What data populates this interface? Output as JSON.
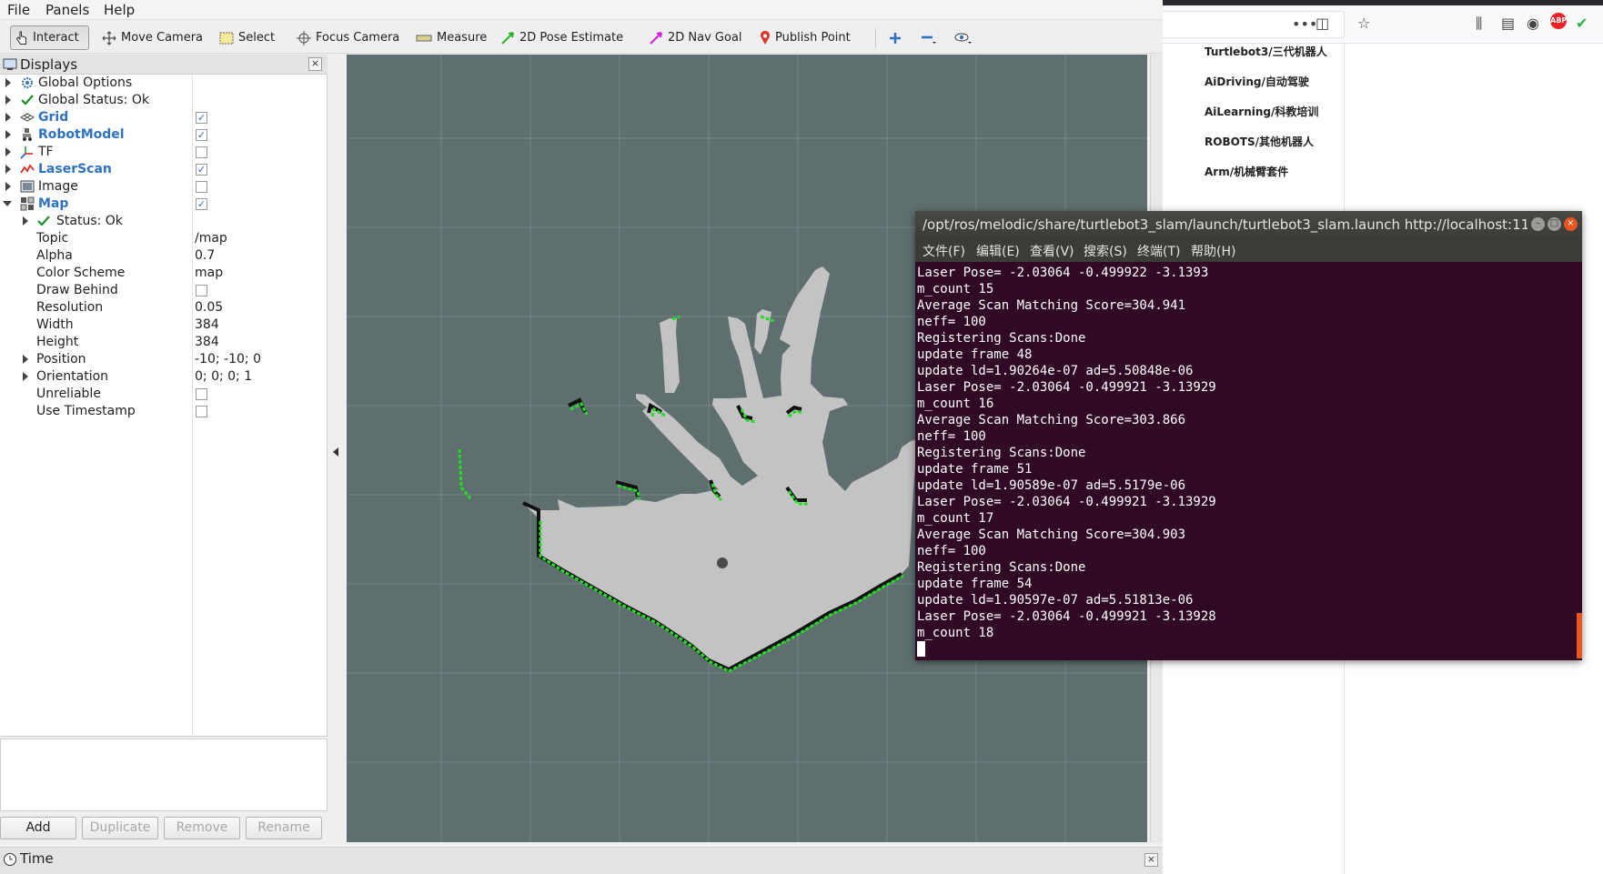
{
  "menubar": {
    "file": "File",
    "panels": "Panels",
    "help": "Help"
  },
  "toolbar": {
    "interact": "Interact",
    "move_camera": "Move Camera",
    "select": "Select",
    "focus_camera": "Focus Camera",
    "measure": "Measure",
    "pose_estimate": "2D Pose Estimate",
    "nav_goal": "2D Nav Goal",
    "publish_point": "Publish Point"
  },
  "displays": {
    "title": "Displays",
    "rows": [
      {
        "label": "Global Options"
      },
      {
        "label": "Global Status: Ok"
      },
      {
        "label": "Grid",
        "checked": true
      },
      {
        "label": "RobotModel",
        "checked": true
      },
      {
        "label": "TF",
        "checked": false
      },
      {
        "label": "LaserScan",
        "checked": true
      },
      {
        "label": "Image",
        "checked": false
      },
      {
        "label": "Map",
        "checked": true
      },
      {
        "label": "Status: Ok"
      },
      {
        "label": "Topic",
        "value": "/map"
      },
      {
        "label": "Alpha",
        "value": "0.7"
      },
      {
        "label": "Color Scheme",
        "value": "map"
      },
      {
        "label": "Draw Behind",
        "checked": false
      },
      {
        "label": "Resolution",
        "value": "0.05"
      },
      {
        "label": "Width",
        "value": "384"
      },
      {
        "label": "Height",
        "value": "384"
      },
      {
        "label": "Position",
        "value": "-10; -10; 0"
      },
      {
        "label": "Orientation",
        "value": "0; 0; 0; 1"
      },
      {
        "label": "Unreliable",
        "checked": false
      },
      {
        "label": "Use Timestamp",
        "checked": false
      }
    ],
    "buttons": {
      "add": "Add",
      "duplicate": "Duplicate",
      "remove": "Remove",
      "rename": "Rename"
    }
  },
  "time_panel": {
    "title": "Time"
  },
  "colors": {
    "view_bg": "#5f6f6f",
    "map_free": "#c3c3c3",
    "laser": "#22dd22",
    "terminal_bg": "#300a24",
    "accent": "#2f72c4"
  },
  "browser": {
    "nav_links": [
      "Turtlebot3/三代机器人",
      "AiDriving/自动驾驶",
      "AiLearning/科教培训",
      "ROBOTS/其他机器人",
      "Arm/机械臂套件"
    ]
  },
  "terminal": {
    "title": "/opt/ros/melodic/share/turtlebot3_slam/launch/turtlebot3_slam.launch http://localhost:11...",
    "menu": [
      "文件(F)",
      "编辑(E)",
      "查看(V)",
      "搜索(S)",
      "终端(T)",
      "帮助(H)"
    ],
    "lines": [
      "Laser Pose= -2.03064 -0.499922 -3.1393",
      "m_count 15",
      "Average Scan Matching Score=304.941",
      "neff= 100",
      "Registering Scans:Done",
      "update frame 48",
      "update ld=1.90264e-07 ad=5.50848e-06",
      "Laser Pose= -2.03064 -0.499921 -3.13929",
      "m_count 16",
      "Average Scan Matching Score=303.866",
      "neff= 100",
      "Registering Scans:Done",
      "update frame 51",
      "update ld=1.90589e-07 ad=5.5179e-06",
      "Laser Pose= -2.03064 -0.499921 -3.13929",
      "m_count 17",
      "Average Scan Matching Score=304.903",
      "neff= 100",
      "Registering Scans:Done",
      "update frame 54",
      "update ld=1.90597e-07 ad=5.51813e-06",
      "Laser Pose= -2.03064 -0.499921 -3.13928",
      "m_count 18"
    ]
  }
}
